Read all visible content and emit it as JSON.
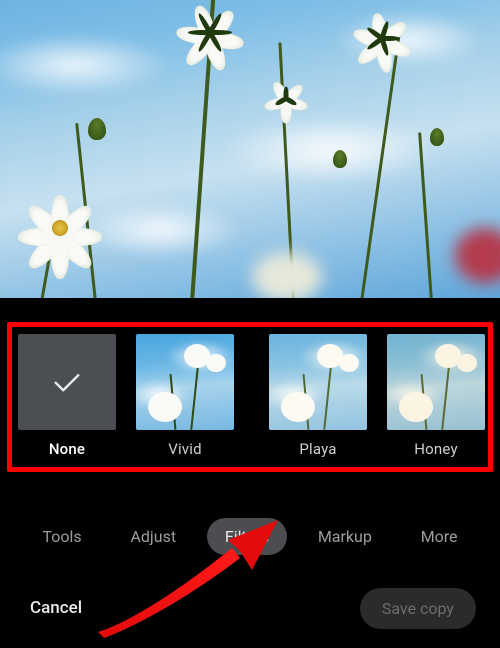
{
  "filters": {
    "items": [
      {
        "id": "none",
        "label": "None",
        "selected": true
      },
      {
        "id": "vivid",
        "label": "Vivid",
        "selected": false
      },
      {
        "id": "playa",
        "label": "Playa",
        "selected": false
      },
      {
        "id": "honey",
        "label": "Honey",
        "selected": false
      }
    ]
  },
  "toolbar": {
    "tabs": [
      {
        "id": "tools",
        "label": "Tools",
        "active": false
      },
      {
        "id": "adjust",
        "label": "Adjust",
        "active": false
      },
      {
        "id": "filters",
        "label": "Filters",
        "active": true
      },
      {
        "id": "markup",
        "label": "Markup",
        "active": false
      },
      {
        "id": "more",
        "label": "More",
        "active": false
      }
    ]
  },
  "actions": {
    "cancel_label": "Cancel",
    "save_label": "Save copy",
    "save_enabled": false
  },
  "annotation": {
    "highlight_box_color": "#fb0102",
    "arrow_color": "#e30b0b",
    "arrow_points_to": "tab-filters"
  }
}
